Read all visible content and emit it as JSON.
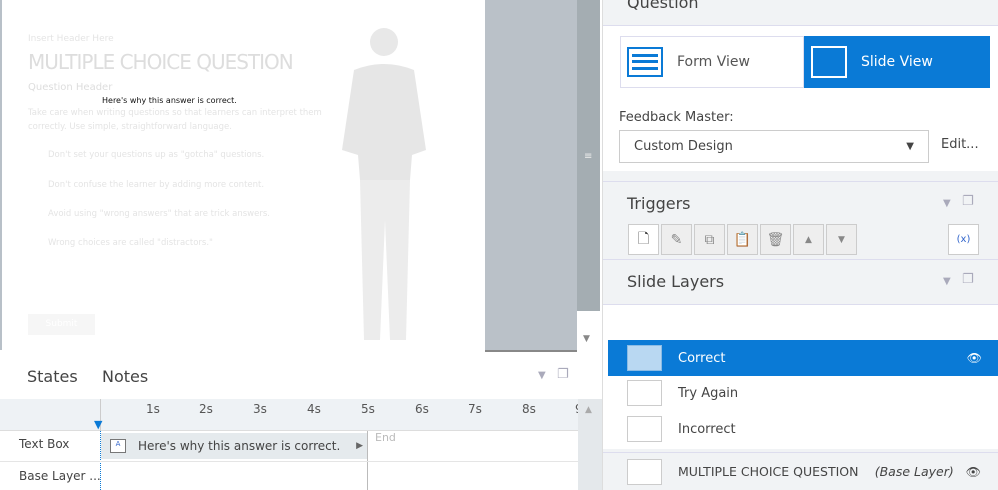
{
  "slide": {
    "insert_header": "Insert Header Here",
    "title": "MULTIPLE CHOICE QUESTION",
    "question_header": "Question Header",
    "feedback_text": "Here's why this answer is correct.",
    "body": "Take care when writing questions so that learners can interpret them correctly. Use simple, straightforward language.",
    "choices": [
      "Don't set your questions up as \"gotcha\" questions.",
      "Don't confuse the learner by adding more content.",
      "Avoid using \"wrong answers\" that are trick answers.",
      "Wrong choices are called \"distractors.\""
    ],
    "submit": "Submit"
  },
  "question_panel": {
    "title": "Question",
    "form_view": "Form View",
    "slide_view": "Slide View",
    "feedback_master_label": "Feedback Master:",
    "feedback_master_value": "Custom Design",
    "edit": "Edit..."
  },
  "triggers": {
    "title": "Triggers"
  },
  "layers": {
    "title": "Slide Layers",
    "items": [
      {
        "name": "Correct"
      },
      {
        "name": "Try Again"
      },
      {
        "name": "Incorrect"
      }
    ],
    "base": {
      "name": "MULTIPLE CHOICE QUESTION",
      "tag": "(Base Layer)"
    }
  },
  "bottom": {
    "tabs": [
      "States",
      "Notes"
    ],
    "ticks": [
      "1s",
      "2s",
      "3s",
      "4s",
      "5s",
      "6s",
      "7s",
      "8s",
      "9"
    ],
    "rows": [
      "Text Box",
      "Base Layer ..."
    ],
    "bar_text": "Here's why this answer is correct.",
    "end": "End"
  }
}
